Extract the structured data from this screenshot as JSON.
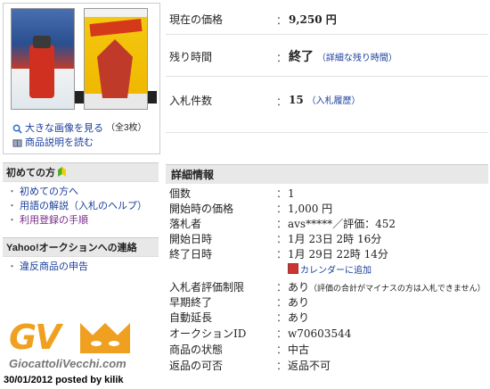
{
  "gallery": {
    "enlarge_link": "大きな画像を見る",
    "enlarge_count": "（全3枚）",
    "read_desc_link": "商品説明を読む"
  },
  "beginners": {
    "title": "初めての方",
    "items": [
      "初めての方へ",
      "用語の解説（入札のヘルプ）",
      "利用登録の手順"
    ]
  },
  "contact": {
    "title": "Yahoo!オークションへの連絡",
    "items": [
      "違反商品の申告"
    ]
  },
  "logo": {
    "mark": "GV",
    "site": "GiocattoliVecchi.com"
  },
  "caption": "30/01/2012 posted by kilik",
  "summary": {
    "price_label": "現在の価格",
    "price_value": "9,250 円",
    "time_label": "残り時間",
    "time_value": "終了",
    "time_link": "（詳細な残り時間）",
    "bids_label": "入札件数",
    "bids_value": "15",
    "bids_link": "（入札履歴）",
    "colon": "："
  },
  "detail": {
    "title": "詳細情報",
    "rows": [
      {
        "label": "個数",
        "value": "1"
      },
      {
        "label": "開始時の価格",
        "value": "1,000 円"
      },
      {
        "label": "落札者",
        "value": "avs*****／評価：452"
      },
      {
        "label": "開始日時",
        "value": "1月 23日 2時 16分"
      },
      {
        "label": "終了日時",
        "value": "1月 29日 22時 14分"
      },
      {
        "label": "入札者評価制限",
        "value": "あり",
        "note": "（評価の合計がマイナスの方は入札できません）"
      },
      {
        "label": "早期終了",
        "value": "あり"
      },
      {
        "label": "自動延長",
        "value": "あり"
      },
      {
        "label": "オークションID",
        "value": "w70603544"
      },
      {
        "label": "商品の状態",
        "value": "中古"
      },
      {
        "label": "返品の可否",
        "value": "返品不可"
      }
    ],
    "calendar_link": "カレンダーに追加"
  }
}
